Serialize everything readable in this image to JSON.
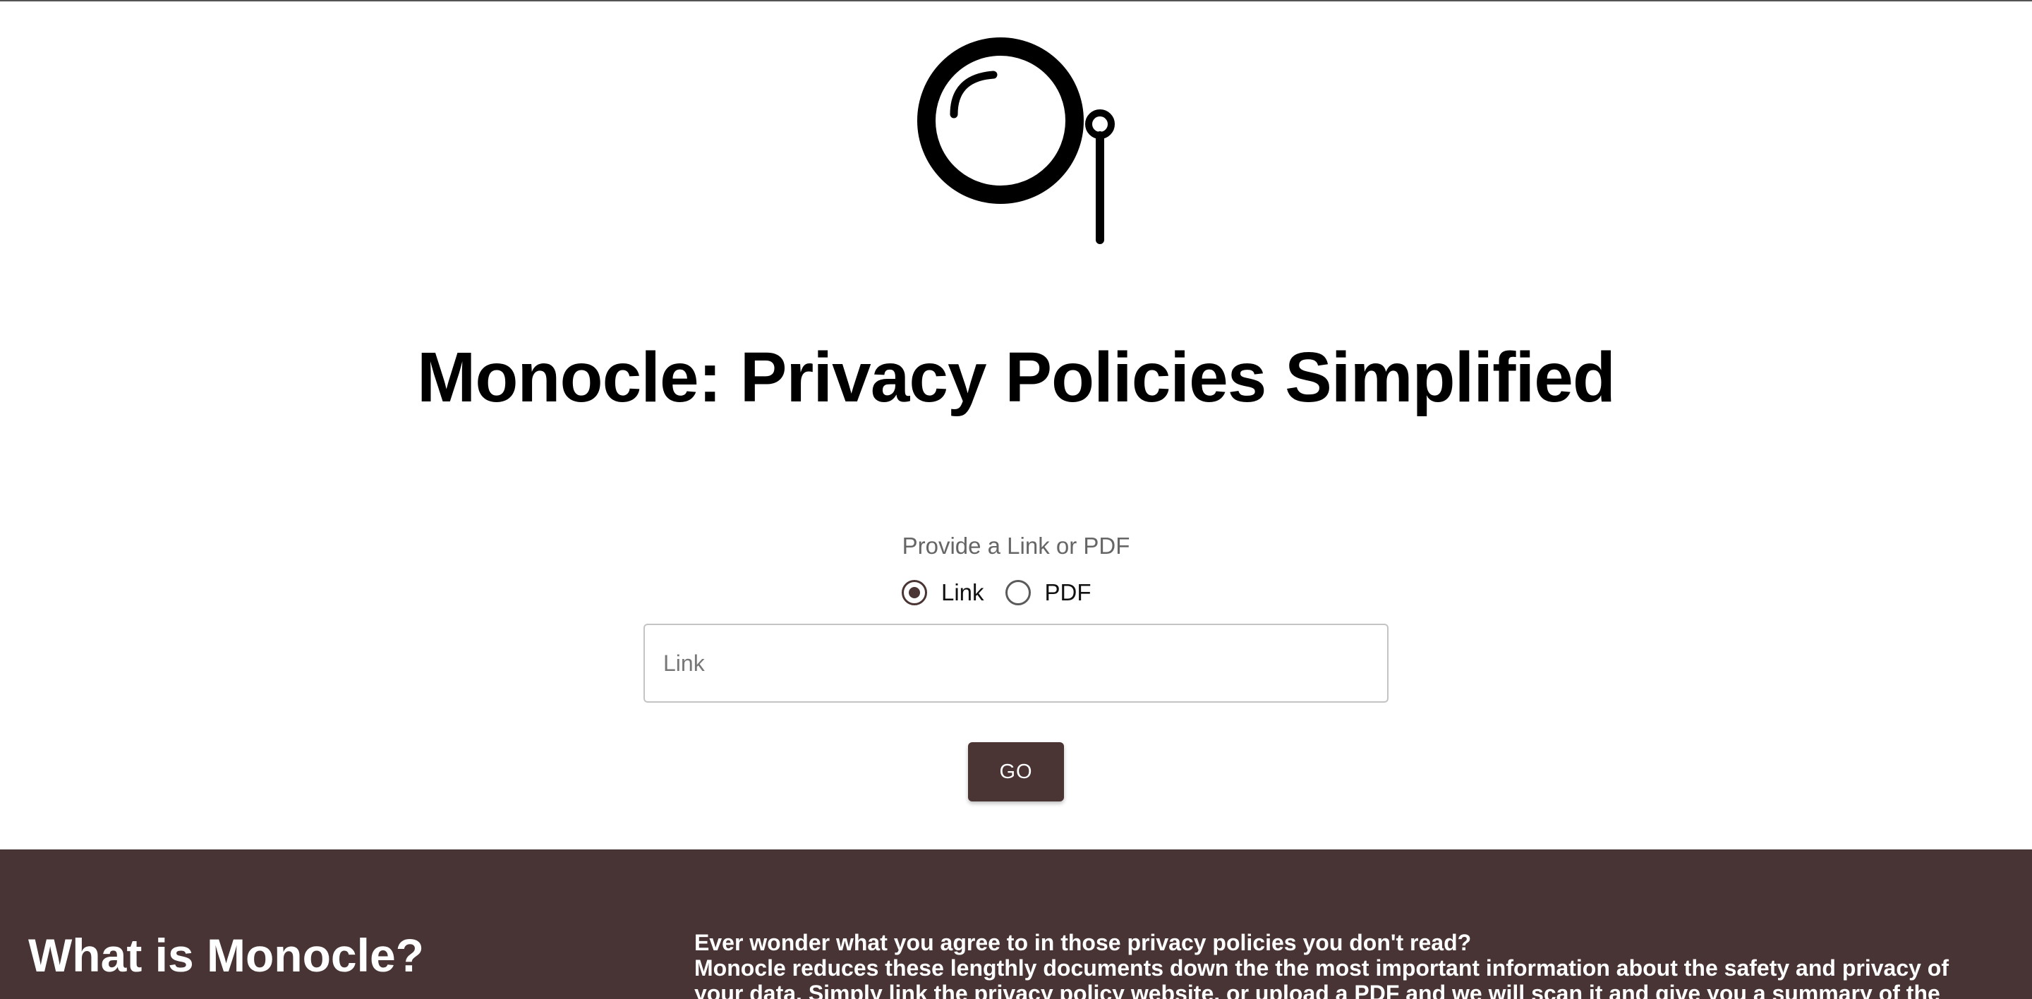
{
  "hero": {
    "logo_icon": "monocle-icon",
    "title": "Monocle: Privacy Policies Simplified"
  },
  "form": {
    "prompt": "Provide a Link or PDF",
    "options": [
      {
        "label": "Link",
        "selected": true
      },
      {
        "label": "PDF",
        "selected": false
      }
    ],
    "link_placeholder": "Link",
    "link_value": "",
    "submit_label": "GO"
  },
  "about": {
    "heading": "What is Monocle?",
    "lead": "Ever wonder what you agree to in those privacy policies you don't read?",
    "body": "Monocle reduces these lengthly documents down the the most important information about the safety and privacy of your data. Simply link the privacy policy website, or upload a PDF and we will scan it and give you a summary of the"
  },
  "colors": {
    "accent": "#483434",
    "background": "#ffffff",
    "text": "#000000"
  }
}
